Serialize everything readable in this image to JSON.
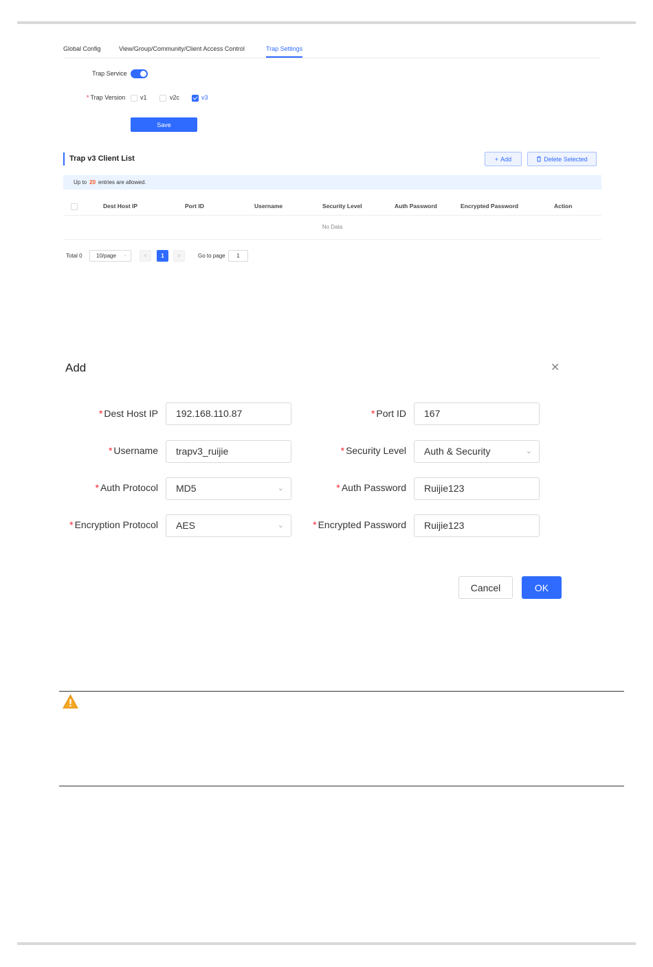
{
  "tabs": [
    {
      "label": "Global Config"
    },
    {
      "label": "View/Group/Community/Client Access Control"
    },
    {
      "label": "Trap Settings"
    }
  ],
  "trap": {
    "service_label": "Trap Service",
    "service_on": true,
    "version_label": "Trap Version",
    "versions": [
      {
        "label": "v1",
        "checked": false
      },
      {
        "label": "v2c",
        "checked": false
      },
      {
        "label": "v3",
        "checked": true
      }
    ],
    "save_label": "Save"
  },
  "client_list": {
    "title": "Trap v3 Client List",
    "add_label": "Add",
    "delete_label": "Delete Selected",
    "notice_prefix": "Up to",
    "notice_count": "20",
    "notice_suffix": "entries are allowed.",
    "columns": [
      "Dest Host IP",
      "Port ID",
      "Username",
      "Security Level",
      "Auth Password",
      "Encrypted Password",
      "Action"
    ],
    "empty_text": "No Data"
  },
  "pagination": {
    "total": "Total 0",
    "page_size": "10/page",
    "prev": "<",
    "current_page": "1",
    "next": ">",
    "goto_label": "Go to page",
    "goto_value": "1"
  },
  "modal": {
    "title": "Add",
    "fields": {
      "dest_host_ip": {
        "label": "Dest Host IP",
        "value": "192.168.110.87"
      },
      "port_id": {
        "label": "Port ID",
        "value": "167"
      },
      "username": {
        "label": "Username",
        "value": "trapv3_ruijie"
      },
      "security_level": {
        "label": "Security Level",
        "value": "Auth & Security"
      },
      "auth_protocol": {
        "label": "Auth Protocol",
        "value": "MD5"
      },
      "auth_password": {
        "label": "Auth Password",
        "value": "Ruijie123"
      },
      "encryption_protocol": {
        "label": "Encryption Protocol",
        "value": "AES"
      },
      "encrypted_password": {
        "label": "Encrypted Password",
        "value": "Ruijie123"
      }
    },
    "cancel_label": "Cancel",
    "ok_label": "OK"
  },
  "colors": {
    "primary": "#2f6bff",
    "required": "#f5222d",
    "warning": "#f5a623"
  }
}
